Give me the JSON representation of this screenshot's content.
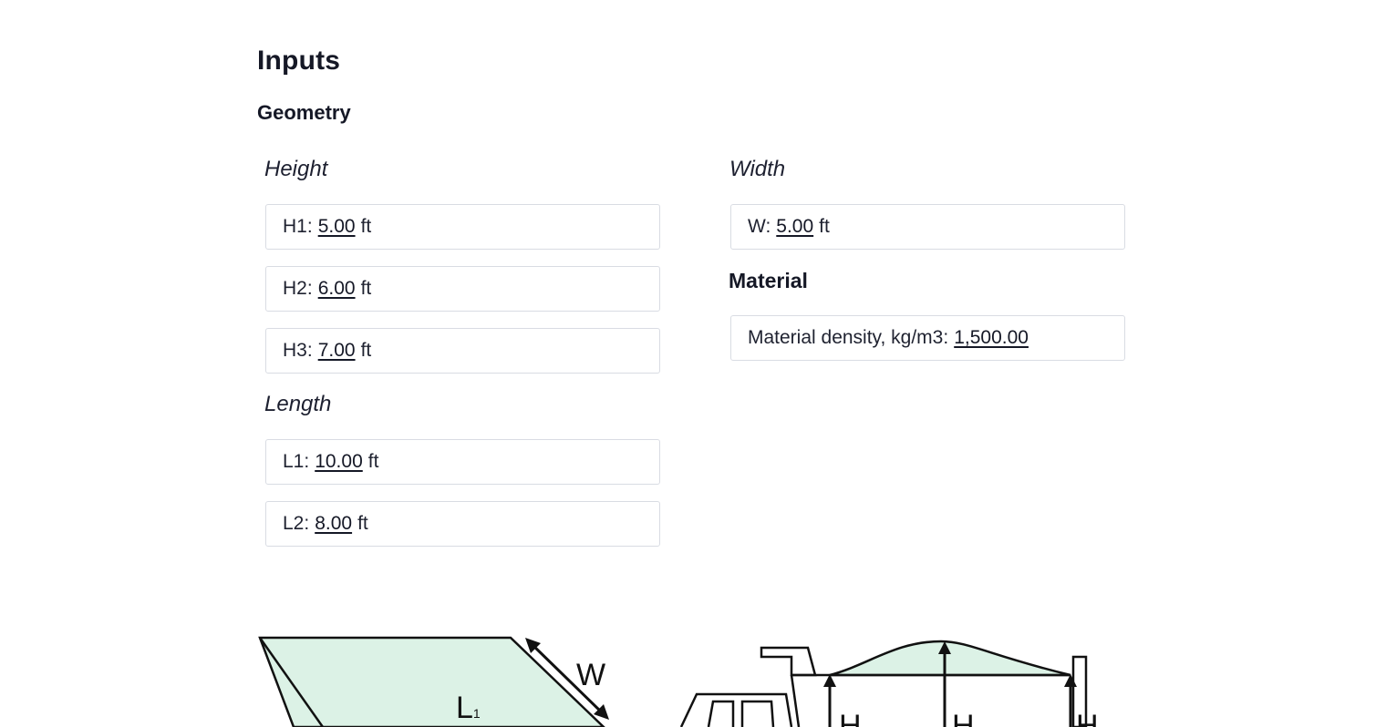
{
  "title": "Inputs",
  "geometry": {
    "heading": "Geometry",
    "height": {
      "label": "Height",
      "fields": [
        {
          "label": "H1:",
          "value": "5.00",
          "unit": "ft"
        },
        {
          "label": "H2:",
          "value": "6.00",
          "unit": "ft"
        },
        {
          "label": "H3:",
          "value": "7.00",
          "unit": "ft"
        }
      ]
    },
    "length": {
      "label": "Length",
      "fields": [
        {
          "label": "L1:",
          "value": "10.00",
          "unit": "ft"
        },
        {
          "label": "L2:",
          "value": "8.00",
          "unit": "ft"
        }
      ]
    },
    "width": {
      "label": "Width",
      "fields": [
        {
          "label": "W:",
          "value": "5.00",
          "unit": "ft"
        }
      ]
    }
  },
  "material": {
    "heading": "Material",
    "fields": [
      {
        "label": "Material density, kg/m3:",
        "value": "1,500.00",
        "unit": ""
      }
    ]
  },
  "diagrams": {
    "left_labels": {
      "width": "W",
      "length": "L",
      "length_sub": "1"
    },
    "right_labels": {
      "h": "H"
    },
    "fill_color": "#dcf2e6",
    "stroke_color": "#111111"
  }
}
